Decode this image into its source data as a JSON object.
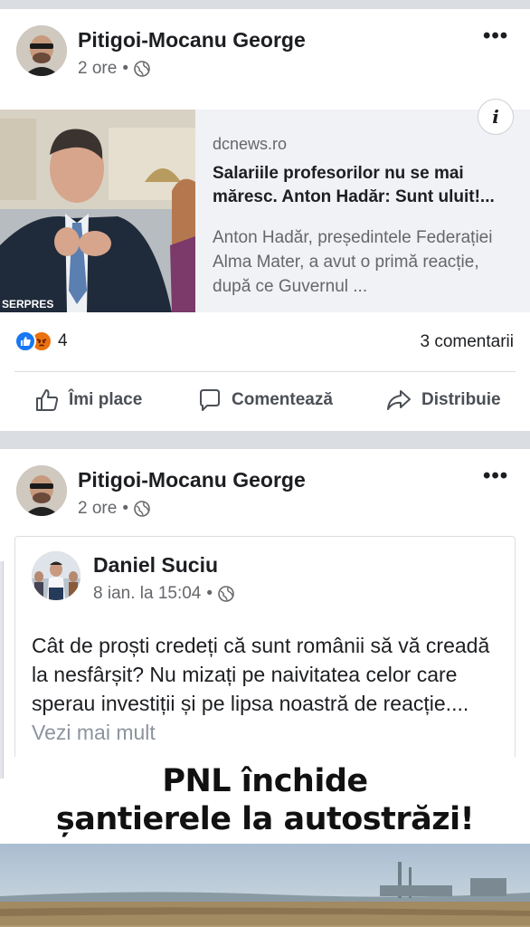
{
  "posts": [
    {
      "author": "Pitigoi-Mocanu George",
      "time": "2 ore",
      "more": "•••",
      "link": {
        "domain": "dcnews.ro",
        "title": "Salariile profesorilor nu se mai măresc. Anton Hadăr: Sunt uluit!...",
        "description": "Anton Hadăr, președintele Federației Alma Mater, a avut o primă reacție, după ce Guvernul ...",
        "image_caption": "SERPRES",
        "info_icon": "info-icon"
      },
      "reactions": {
        "icons": [
          "like-icon",
          "angry-icon"
        ],
        "count": "4"
      },
      "comments": "3 comentarii",
      "actions": {
        "like": "Îmi place",
        "comment": "Comentează",
        "share": "Distribuie"
      }
    },
    {
      "author": "Pitigoi-Mocanu George",
      "time": "2 ore",
      "more": "•••",
      "shared": {
        "author": "Daniel Suciu",
        "time": "8 ian. la 15:04",
        "text": "Cât de proști credeți că sunt românii să vă creadă la nesfârșit? Nu mizați pe naivitatea celor care sperau investiții și pe lipsa noastră de reacție.... ",
        "more": "Vezi mai mult",
        "image_headline_1": "PNL închide",
        "image_headline_2": "șantierele la autostrăzi!"
      }
    }
  ],
  "colors": {
    "like_blue": "#1877f2",
    "angry_orange": "#e9710f",
    "secondary_text": "#65676b",
    "card_bg": "#f0f2f5"
  }
}
